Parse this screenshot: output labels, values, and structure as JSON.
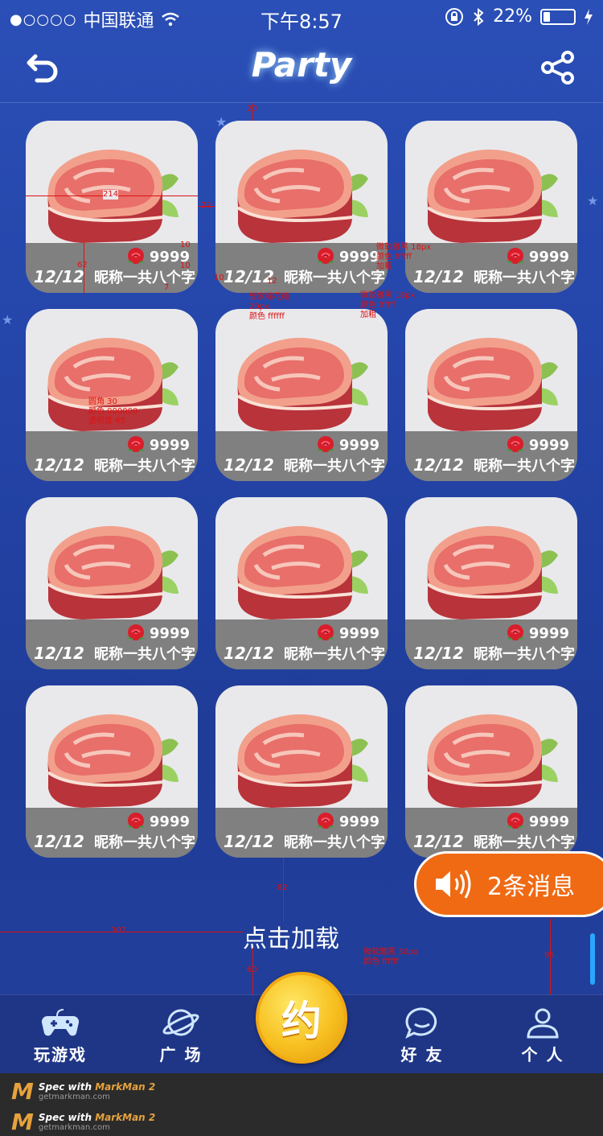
{
  "status_bar": {
    "carrier": "中国联通",
    "time": "下午8:57",
    "battery": "22%",
    "battery_level": 0.22
  },
  "nav": {
    "title": "Party",
    "back_icon": "back-arrow-icon",
    "share_icon": "share-icon"
  },
  "cards": [
    {
      "count": "12/12",
      "name": "昵称一共八个字",
      "roses": "9999"
    },
    {
      "count": "12/12",
      "name": "昵称一共八个字",
      "roses": "9999"
    },
    {
      "count": "12/12",
      "name": "昵称一共八个字",
      "roses": "9999"
    },
    {
      "count": "12/12",
      "name": "昵称一共八个字",
      "roses": "9999"
    },
    {
      "count": "12/12",
      "name": "昵称一共八个字",
      "roses": "9999"
    },
    {
      "count": "12/12",
      "name": "昵称一共八个字",
      "roses": "9999"
    },
    {
      "count": "12/12",
      "name": "昵称一共八个字",
      "roses": "9999"
    },
    {
      "count": "12/12",
      "name": "昵称一共八个字",
      "roses": "9999"
    },
    {
      "count": "12/12",
      "name": "昵称一共八个字",
      "roses": "9999"
    },
    {
      "count": "12/12",
      "name": "昵称一共八个字",
      "roses": "9999"
    },
    {
      "count": "12/12",
      "name": "昵称一共八个字",
      "roses": "9999"
    },
    {
      "count": "12/12",
      "name": "昵称一共八个字",
      "roses": "9999"
    }
  ],
  "load_more": "点击加载",
  "message": {
    "text": "2条消息"
  },
  "tabs": {
    "play": "玩游戏",
    "square": "广 场",
    "center": "约",
    "friends": "好 友",
    "me": "个 人"
  },
  "footer": {
    "line_prefix": "Spec with",
    "brand": "MarkMan 2",
    "url": "getmarkman.com"
  },
  "annotations": {
    "w214": "214",
    "g22": "22",
    "g20": "20",
    "h62": "62",
    "p10a": "10",
    "p10b": "10",
    "p7": "7",
    "p10c": "10",
    "p12": "12",
    "rose_font": [
      "微软雅黑 18px",
      "颜色 ffffff",
      "加粗"
    ],
    "name_font": [
      "微软雅黑 18px",
      "颜色 ffffff",
      "加粗"
    ],
    "count_font": [
      "管家棉花糖",
      "20px",
      "颜色 ffffff"
    ],
    "overlay_spec": [
      "圆角 30",
      "颜色 000000",
      "透明度 45"
    ],
    "d302": "302",
    "d82": "82",
    "load_font": [
      "微软雅黑 30px",
      "颜色 ffffff"
    ],
    "d60": "60",
    "d95": "95"
  },
  "colors": {
    "background": "#2444a8",
    "card": "#e9e9ec",
    "overlay": "rgba(0,0,0,0.45)",
    "message_pill": "#ef6a13",
    "center_button": "#f7c020",
    "spec": "#dd1111"
  }
}
